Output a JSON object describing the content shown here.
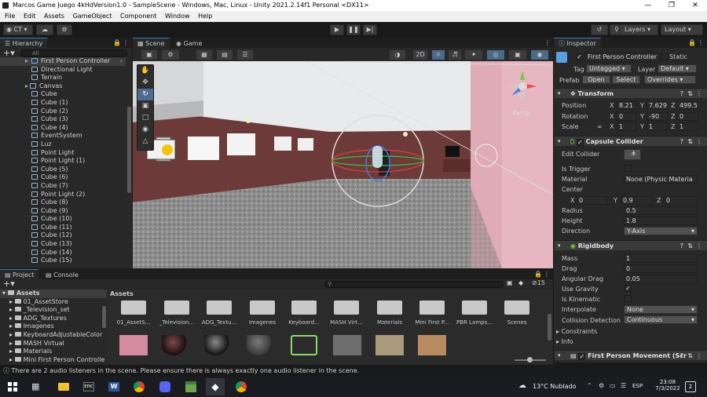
{
  "window": {
    "title": "Marcos Game Juego 4kHdVersion1.0 - SampleScene - Windows, Mac, Linux - Unity 2021.2.14f1 Personal <DX11>"
  },
  "menu": [
    "File",
    "Edit",
    "Assets",
    "GameObject",
    "Component",
    "Window",
    "Help"
  ],
  "toolbar": {
    "account": "CT",
    "layers": "Layers",
    "layout": "Layout"
  },
  "hierarchy": {
    "tab": "Hierarchy",
    "search_placeholder": "All",
    "items": [
      "First Person Controller",
      "Directional Light",
      "Terrain",
      "Canvas",
      "Cube",
      "Cube (1)",
      "Cube (2)",
      "Cube (3)",
      "Cube (4)",
      "EventSystem",
      "Luz",
      "Point Light",
      "Point Light (1)",
      "Cube (5)",
      "Cube (6)",
      "Cube (7)",
      "Point Light (2)",
      "Cube (8)",
      "Cube (9)",
      "Cube (10)",
      "Cube (11)",
      "Cube (12)",
      "Cube (13)",
      "Cube (14)",
      "Cube (15)"
    ]
  },
  "scene": {
    "tabs": [
      "Scene",
      "Game"
    ],
    "mode_2d": "2D",
    "persp": "Persp"
  },
  "inspector": {
    "tab": "Inspector",
    "object_name": "First Person Controller",
    "static_label": "Static",
    "tag_label": "Tag",
    "tag_value": "Untagged",
    "layer_label": "Layer",
    "layer_value": "Default",
    "prefab_label": "Prefab",
    "open": "Open",
    "select": "Select",
    "overrides": "Overrides",
    "transform": {
      "title": "Transform",
      "position_label": "Position",
      "pos": [
        "8.21",
        "7.629",
        "499.5"
      ],
      "rotation_label": "Rotation",
      "rot": [
        "0",
        "-90",
        "0"
      ],
      "scale_label": "Scale",
      "scale": [
        "1",
        "1",
        "1"
      ]
    },
    "capsule": {
      "title": "Capsule Collider",
      "edit_collider": "Edit Collider",
      "is_trigger": "Is Trigger",
      "material_label": "Material",
      "material_value": "None (Physic Materia",
      "center_label": "Center",
      "center": [
        "0",
        "0.9",
        "0"
      ],
      "radius_label": "Radius",
      "radius": "0.5",
      "height_label": "Height",
      "height": "1.8",
      "direction_label": "Direction",
      "direction": "Y-Axis"
    },
    "rigidbody": {
      "title": "Rigidbody",
      "mass_label": "Mass",
      "mass": "1",
      "drag_label": "Drag",
      "drag": "0",
      "angular_label": "Angular Drag",
      "angular": "0.05",
      "gravity_label": "Use Gravity",
      "kinematic_label": "Is Kinematic",
      "interpolate_label": "Interpolate",
      "interpolate": "None",
      "collision_label": "Collision Detection",
      "collision": "Continuous",
      "constraints": "Constraints",
      "info": "Info"
    },
    "movement_title": "First Person Movement (Scr"
  },
  "project": {
    "tabs": [
      "Project",
      "Console"
    ],
    "assets_header": "Assets",
    "badge": "15",
    "tree": [
      "Assets",
      "01_AssetStore",
      "_Television_set",
      "ADG_Textures",
      "Imagenes",
      "KeyboardAdjustableColor",
      "MASH Virtual",
      "Materials",
      "Mini First Person Controlle"
    ],
    "folders": [
      "01_AssetS...",
      "_Television...",
      "ADG_Textu...",
      "Imagenes",
      "Keyboard...",
      "MASH Virt...",
      "Materials",
      "Mini First P...",
      "PBR Lamps...",
      "Scenes"
    ]
  },
  "status": "There are 2 audio listeners in the scene. Please ensure there is always exactly one audio listener in the scene.",
  "taskbar": {
    "weather": "13°C  Nublado",
    "lang": "ESP",
    "time": "23:08",
    "date": "7/3/2022",
    "notif": "2"
  }
}
